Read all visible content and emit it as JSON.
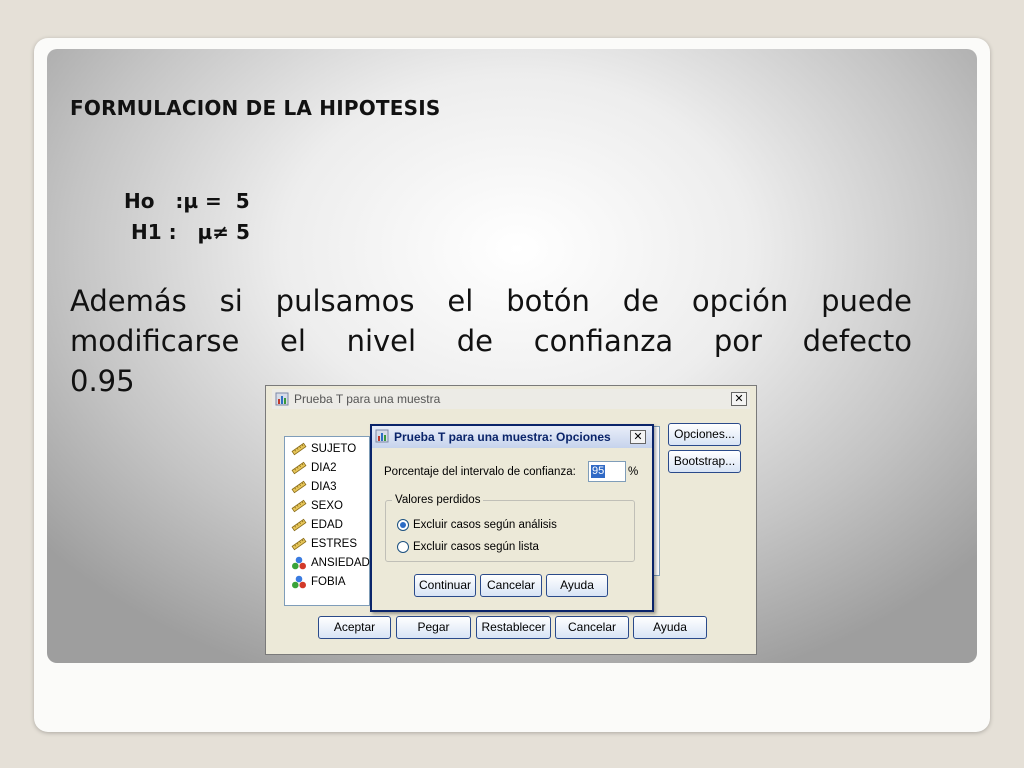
{
  "slide": {
    "title": "FORMULACION DE LA HIPOTESIS",
    "h0": "Ho   :µ =  5",
    "h1": "H1 :   µ≠ 5",
    "paragraph_lines": [
      "Además si pulsamos el botón de opción puede",
      "modificarse el nivel de confianza por defecto",
      "0.95"
    ]
  },
  "main_dialog": {
    "title": "Prueba T para una muestra",
    "close_label": "✕",
    "variables": [
      {
        "name": "SUJETO",
        "icon": "ruler-icon"
      },
      {
        "name": "DIA2",
        "icon": "ruler-icon"
      },
      {
        "name": "DIA3",
        "icon": "ruler-icon"
      },
      {
        "name": "SEXO",
        "icon": "ruler-icon"
      },
      {
        "name": "EDAD",
        "icon": "ruler-icon"
      },
      {
        "name": "ESTRES",
        "icon": "ruler-icon"
      },
      {
        "name": "ANSIEDAD",
        "icon": "nominal-balls-icon"
      },
      {
        "name": "FOBIA",
        "icon": "nominal-balls-icon"
      }
    ],
    "side_buttons": {
      "options": "Opciones...",
      "bootstrap": "Bootstrap..."
    },
    "bottom_buttons": {
      "accept": "Aceptar",
      "paste": "Pegar",
      "reset": "Restablecer",
      "cancel": "Cancelar",
      "help": "Ayuda"
    }
  },
  "options_dialog": {
    "title": "Prueba T para una muestra: Opciones",
    "close_label": "✕",
    "confidence_label": "Porcentaje del intervalo de confianza:",
    "confidence_value": "95",
    "percent_sign": "%",
    "missing_group_label": "Valores perdidos",
    "radio_analysis": "Excluir casos según análisis",
    "radio_list": "Excluir casos según lista",
    "selected_radio": "analysis",
    "buttons": {
      "continue": "Continuar",
      "cancel": "Cancelar",
      "help": "Ayuda"
    }
  },
  "colors": {
    "title_bar_active": "#0a246a",
    "button_border": "#2a4a8a",
    "selection": "#316ac5",
    "dialog_face": "#ece9d8"
  }
}
